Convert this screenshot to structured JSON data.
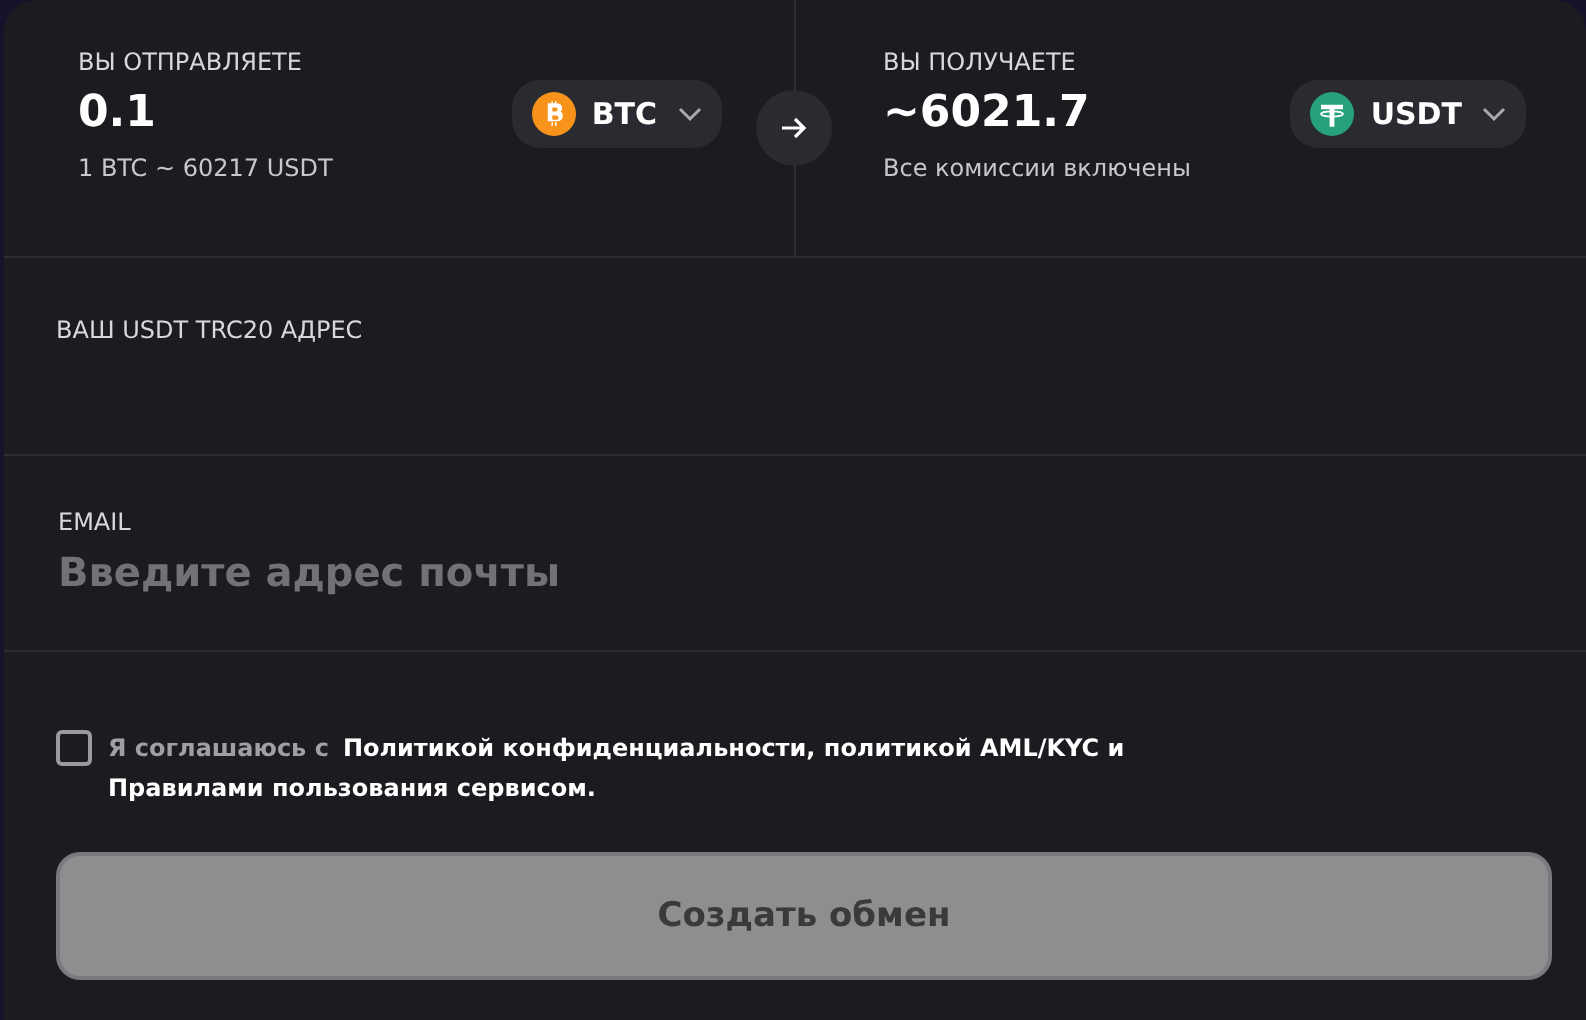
{
  "send": {
    "label": "ВЫ ОТПРАВЛЯЕТЕ",
    "amount": "0.1",
    "rate": "1 BTC ~ 60217 USDT",
    "currency": {
      "code": "BTC",
      "kind": "bitcoin"
    }
  },
  "receive": {
    "label": "ВЫ ПОЛУЧАЕТЕ",
    "amount": "~6021.7",
    "note": "Все комиссии включены",
    "currency": {
      "code": "USDT",
      "kind": "tether"
    }
  },
  "address": {
    "label": "ВАШ USDT TRC20 АДРЕС"
  },
  "email": {
    "label": "EMAIL",
    "placeholder": "Введите адрес почты"
  },
  "agreement": {
    "checked": false,
    "prefix": "Я соглашаюсь с",
    "links": [
      "Политикой конфиденциальности, политикой AML/KYC и",
      "Правилами пользования сервисом."
    ]
  },
  "submit": {
    "label": "Создать обмен",
    "disabled": true
  }
}
